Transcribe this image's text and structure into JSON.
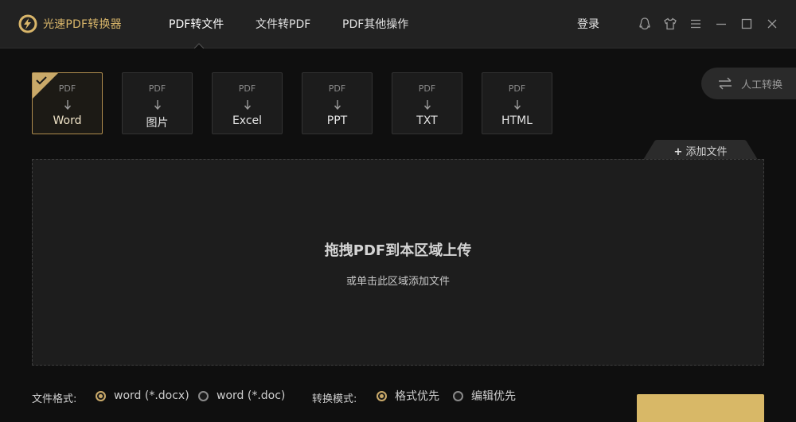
{
  "app": {
    "title": "光速PDF转换器",
    "accent_color": "#d9b66a"
  },
  "nav": {
    "tabs": [
      {
        "label": "PDF转文件",
        "active": true
      },
      {
        "label": "文件转PDF",
        "active": false
      },
      {
        "label": "PDF其他操作",
        "active": false
      }
    ]
  },
  "header": {
    "login_label": "登录",
    "icons": [
      "qq-icon",
      "shirt-icon",
      "menu-icon",
      "minimize-icon",
      "maximize-icon",
      "close-icon"
    ]
  },
  "formats": [
    {
      "source": "PDF",
      "target": "Word",
      "selected": true
    },
    {
      "source": "PDF",
      "target": "图片",
      "selected": false
    },
    {
      "source": "PDF",
      "target": "Excel",
      "selected": false
    },
    {
      "source": "PDF",
      "target": "PPT",
      "selected": false
    },
    {
      "source": "PDF",
      "target": "TXT",
      "selected": false
    },
    {
      "source": "PDF",
      "target": "HTML",
      "selected": false
    }
  ],
  "manual_convert": {
    "label": "人工转换"
  },
  "add_file": {
    "label": "添加文件"
  },
  "dropzone": {
    "title": "拖拽PDF到本区域上传",
    "subtitle": "或单击此区域添加文件"
  },
  "options": {
    "file_format_label": "文件格式:",
    "file_formats": [
      {
        "label": "word (*.docx)",
        "selected": true
      },
      {
        "label": "word (*.doc)",
        "selected": false
      }
    ],
    "mode_label": "转换模式:",
    "modes": [
      {
        "label": "格式优先",
        "selected": true
      },
      {
        "label": "编辑优先",
        "selected": false
      }
    ]
  }
}
